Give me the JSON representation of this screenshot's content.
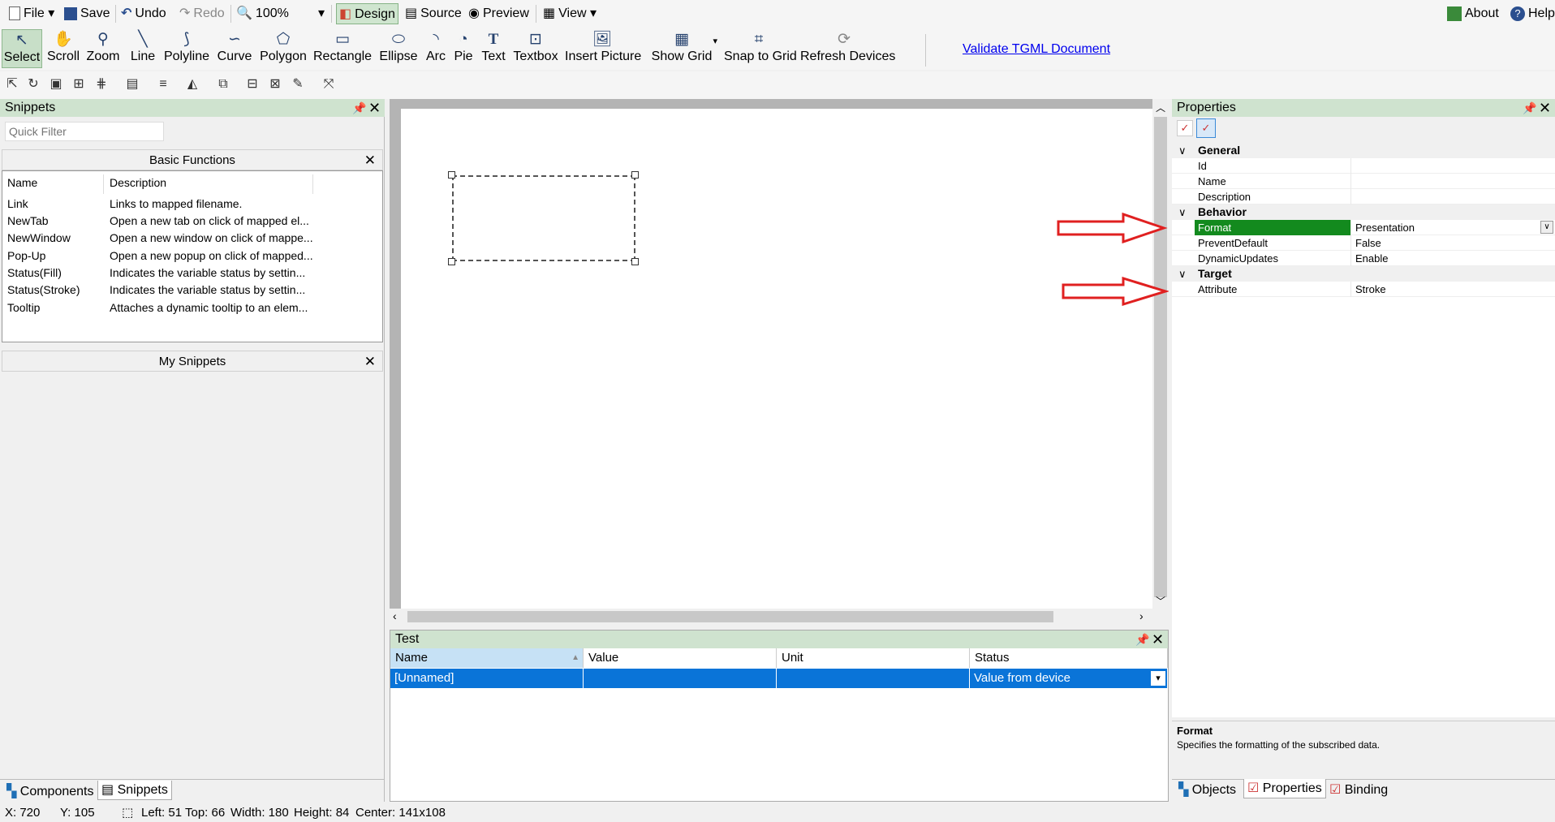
{
  "menubar": {
    "file": "File",
    "save": "Save",
    "undo": "Undo",
    "redo": "Redo",
    "zoom": "100%",
    "design": "Design",
    "source": "Source",
    "preview": "Preview",
    "view": "View",
    "about": "About",
    "help": "Help"
  },
  "toolbar": {
    "tools": [
      "Select",
      "Scroll",
      "Zoom",
      "Line",
      "Polyline",
      "Curve",
      "Polygon",
      "Rectangle",
      "Ellipse",
      "Arc",
      "Pie",
      "Text",
      "Textbox",
      "Insert Picture",
      "Show Grid",
      "Snap to Grid",
      "Refresh Devices"
    ],
    "validate": "Validate TGML Document"
  },
  "snippets": {
    "title": "Snippets",
    "filter_placeholder": "Quick Filter",
    "basic_title": "Basic Functions",
    "col_name": "Name",
    "col_desc": "Description",
    "rows": [
      {
        "name": "Link",
        "desc": "Links to mapped filename."
      },
      {
        "name": "NewTab",
        "desc": "Open a new tab on click of mapped el..."
      },
      {
        "name": "NewWindow",
        "desc": "Open a new window on click of mappe..."
      },
      {
        "name": "Pop-Up",
        "desc": "Open a new popup on click of mapped..."
      },
      {
        "name": "Status(Fill)",
        "desc": "Indicates the variable status by settin..."
      },
      {
        "name": "Status(Stroke)",
        "desc": "Indicates the variable status by settin..."
      },
      {
        "name": "Tooltip",
        "desc": "Attaches a dynamic tooltip to an elem..."
      }
    ],
    "my_title": "My Snippets",
    "tab_components": "Components",
    "tab_snippets": "Snippets"
  },
  "test": {
    "title": "Test",
    "cols": [
      "Name",
      "Value",
      "Unit",
      "Status"
    ],
    "row": {
      "name": "[Unnamed]",
      "value": "",
      "unit": "",
      "status": "Value from device"
    }
  },
  "properties": {
    "title": "Properties",
    "cat_general": "General",
    "id": "Id",
    "name": "Name",
    "description": "Description",
    "cat_behavior": "Behavior",
    "format": "Format",
    "format_val": "Presentation",
    "preventdefault": "PreventDefault",
    "preventdefault_val": "False",
    "dynamicupdates": "DynamicUpdates",
    "dynamicupdates_val": "Enable",
    "cat_target": "Target",
    "attribute": "Attribute",
    "attribute_val": "Stroke",
    "desc_title": "Format",
    "desc_text": "Specifies the formatting of the subscribed data.",
    "tab_objects": "Objects",
    "tab_properties": "Properties",
    "tab_binding": "Binding"
  },
  "status": {
    "x": "X: 720",
    "y": "Y: 105",
    "left": "Left: 51",
    "top": "Top: 66",
    "width": "Width: 180",
    "height": "Height: 84",
    "center": "Center: 141x108"
  },
  "colors": {
    "panel_header": "#cfe3cf",
    "selected_row": "#0a74d8",
    "format_highlight": "#138a1e",
    "arrow": "#e02020"
  }
}
